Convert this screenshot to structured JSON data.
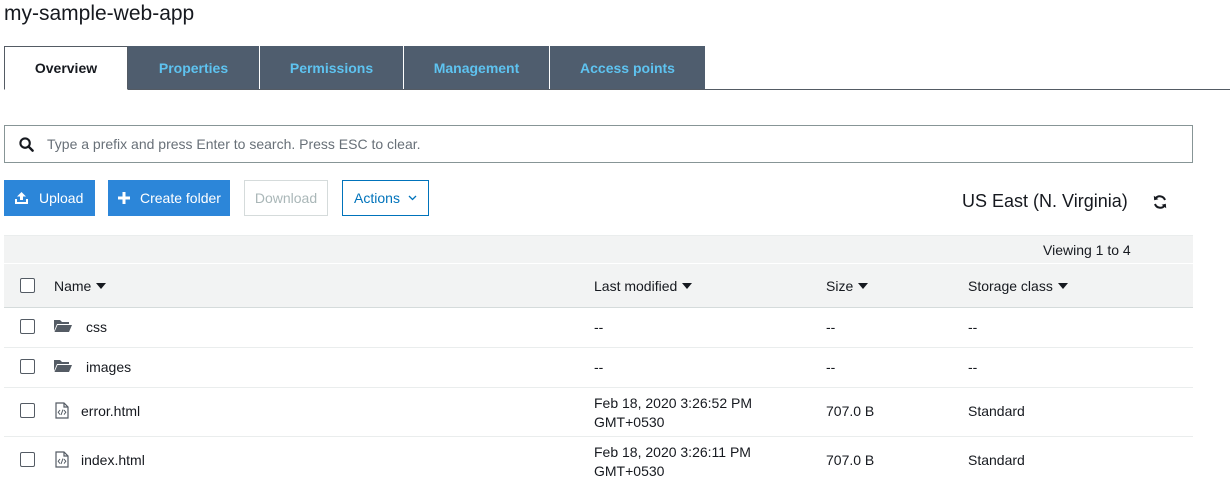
{
  "bucket": {
    "title": "my-sample-web-app"
  },
  "tabs": [
    {
      "label": "Overview",
      "active": true
    },
    {
      "label": "Properties",
      "active": false
    },
    {
      "label": "Permissions",
      "active": false
    },
    {
      "label": "Management",
      "active": false
    },
    {
      "label": "Access points",
      "active": false
    }
  ],
  "search": {
    "placeholder": "Type a prefix and press Enter to search. Press ESC to clear.",
    "value": ""
  },
  "toolbar": {
    "upload_label": "Upload",
    "create_folder_label": "Create folder",
    "download_label": "Download",
    "actions_label": "Actions",
    "region": "US East (N. Virginia)"
  },
  "table": {
    "viewing": "Viewing 1 to 4",
    "columns": {
      "name": "Name",
      "modified": "Last modified",
      "size": "Size",
      "storage": "Storage class"
    },
    "rows": [
      {
        "type": "folder",
        "name": "css",
        "modified_1": "--",
        "modified_2": "",
        "size": "--",
        "storage": "--"
      },
      {
        "type": "folder",
        "name": "images",
        "modified_1": "--",
        "modified_2": "",
        "size": "--",
        "storage": "--"
      },
      {
        "type": "file",
        "name": "error.html",
        "modified_1": "Feb 18, 2020 3:26:52 PM",
        "modified_2": "GMT+0530",
        "size": "707.0 B",
        "storage": "Standard"
      },
      {
        "type": "file",
        "name": "index.html",
        "modified_1": "Feb 18, 2020 3:26:11 PM",
        "modified_2": "GMT+0530",
        "size": "707.0 B",
        "storage": "Standard"
      }
    ]
  },
  "colors": {
    "tab_bg": "#4f5d6e",
    "tab_text": "#5ec3f0",
    "primary": "#2c86d9",
    "link": "#0073bb"
  }
}
